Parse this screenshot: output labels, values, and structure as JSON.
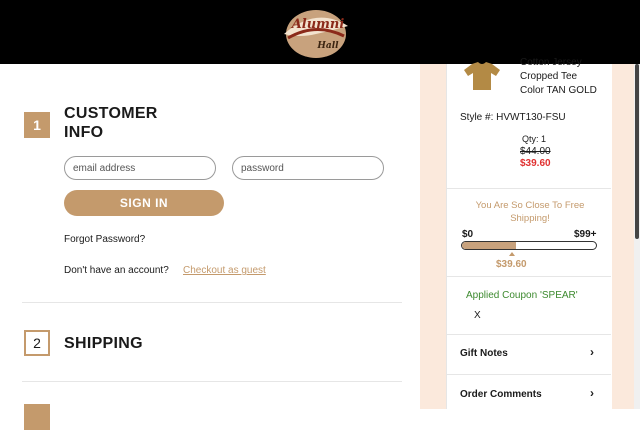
{
  "header": {
    "logo_alt": "Alumni Hall"
  },
  "checkout": {
    "step1": {
      "number": "1",
      "title": "CUSTOMER INFO"
    },
    "login": {
      "email_placeholder": "email address",
      "password_placeholder": "password",
      "signin_label": "SIGN IN",
      "forgot_password": "Forgot Password?",
      "no_account_text": "Don't have an account?",
      "guest_link": "Checkout as guest"
    },
    "step2": {
      "number": "2",
      "title": "SHIPPING"
    }
  },
  "cart": {
    "item": {
      "name_lines": [
        "Cotton Jersey",
        "Cropped Tee",
        "Color TAN GOLD"
      ],
      "style": "Style #: HVWT130-FSU",
      "qty": "Qty: 1",
      "original_price": "$44.00",
      "sale_price": "$39.60"
    },
    "free_shipping": {
      "message": "You Are So Close To Free Shipping!",
      "min_label": "$0",
      "max_label": "$99+",
      "current_label": "$39.60",
      "progress": 0.4
    },
    "coupon": {
      "applied_text": "Applied Coupon 'SPEAR'",
      "remove_label": "X"
    },
    "gift_notes": "Gift Notes",
    "order_comments": "Order Comments"
  },
  "colors": {
    "accent": "#c49a6c",
    "sale_red": "#e03030",
    "coupon_green": "#3d8a2f",
    "header_bg": "#000000"
  }
}
